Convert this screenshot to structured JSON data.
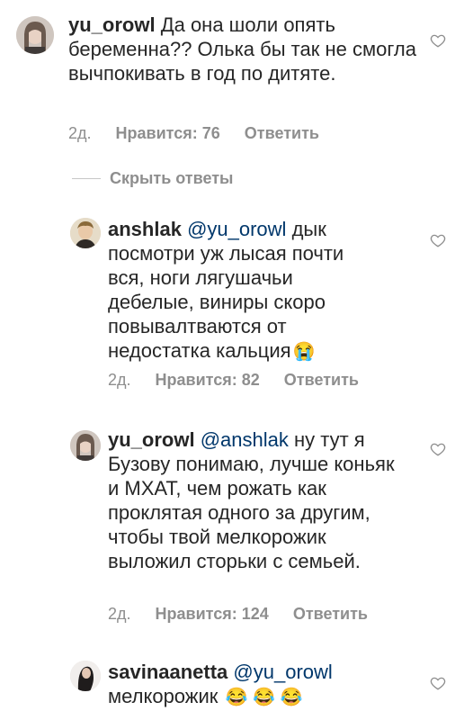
{
  "comments": [
    {
      "username": "yu_orowl",
      "mention": "",
      "text": "Да она шоли опять беременна?? Олька бы так не смогла вычпокивать в год по дитяте.",
      "date": "2д.",
      "likes": "Нравится: 76",
      "reply": "Ответить",
      "emoji": ""
    },
    {
      "username": "anshlak",
      "mention": "@yu_orowl",
      "text": " дык посмотри уж лысая почти вся, ноги лягушачьи дебелые, виниры скоро повывалтваются от недостатка кальция",
      "date": "2д.",
      "likes": "Нравится: 82",
      "reply": "Ответить",
      "emoji": "😭"
    },
    {
      "username": "yu_orowl",
      "mention": "@anshlak",
      "text": " ну тут я Бузову понимаю, лучше коньяк и МХАТ, чем рожать как проклятая одного за другим, чтобы твой мелкорожик выложил сторьки с семьей.",
      "date": "2д.",
      "likes": "Нравится: 124",
      "reply": "Ответить",
      "emoji": ""
    },
    {
      "username": "savinaanetta",
      "mention": "@yu_orowl",
      "text": " мелкорожик",
      "date": "",
      "likes": "",
      "reply": "",
      "emoji": "😂 😂 😂"
    }
  ],
  "hide_replies": "Скрыть ответы",
  "icons": {
    "like": "heart-icon",
    "avatar": "avatar-icon"
  },
  "colors": {
    "text": "#262626",
    "meta": "#8e8e8e",
    "mention": "#00376b"
  }
}
